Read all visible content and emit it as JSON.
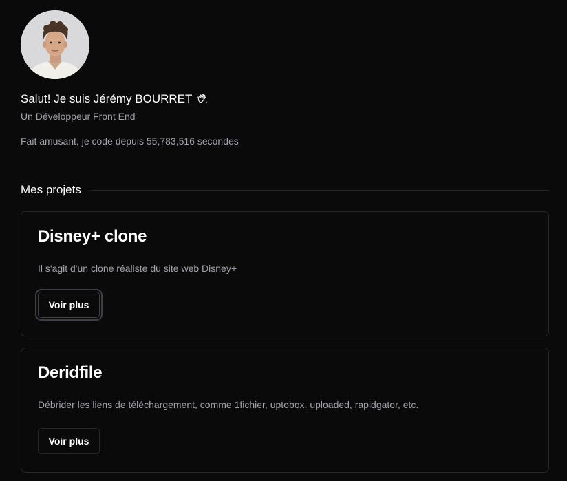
{
  "profile": {
    "greeting": "Salut! Je suis Jérémy BOURRET",
    "greeting_icon": "waving-hand-icon",
    "role": "Un Développeur Front End",
    "fun_fact": "Fait amusant, je code depuis 55,783,516 secondes"
  },
  "projects_section": {
    "title": "Mes projets",
    "items": [
      {
        "title": "Disney+ clone",
        "description": "Il s'agit d'un clone réaliste du site web Disney+",
        "button_label": "Voir plus"
      },
      {
        "title": "Deridfile",
        "description": "Débrider les liens de téléchargement, comme 1fichier, uptobox, uploaded, rapidgator, etc.",
        "button_label": "Voir plus"
      }
    ]
  },
  "colors": {
    "background": "#0a0a0b",
    "text_primary": "#ffffff",
    "text_muted": "#a1a1aa",
    "border": "#27272a"
  }
}
